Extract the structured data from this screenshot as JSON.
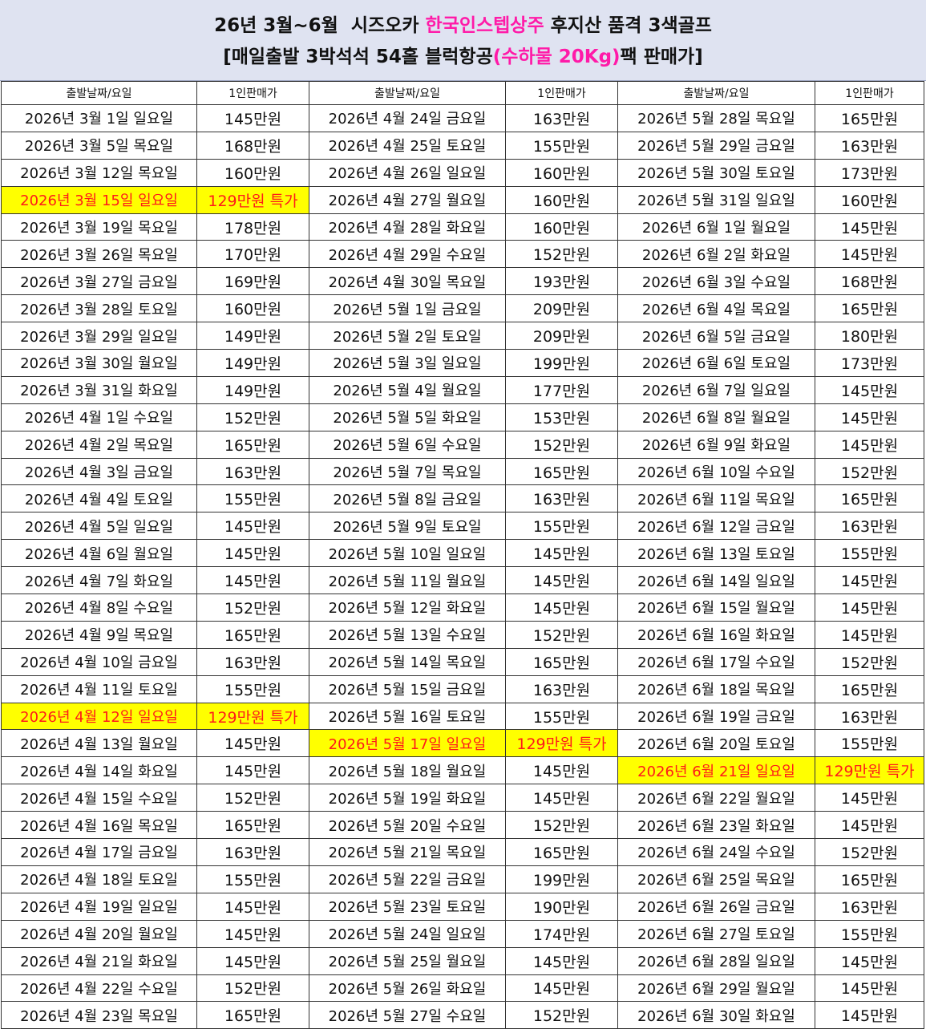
{
  "title": {
    "line1_a": "26년 3월~6월  시즈오카 ",
    "line1_b": "한국인스텝상주",
    "line1_c": " 후지산 품격 3색골프",
    "line2_a": "[매일출발 3박석석 54홀 블럭항공",
    "line2_b": "(수하물 20Kg)",
    "line2_c": "팩 판매가]"
  },
  "headers": {
    "date": "출발날짜/요일",
    "price": "1인판매가"
  },
  "colors": {
    "highlight_bg": "#ffff00",
    "highlight_text": "#ff1a1a",
    "accent_pink": "#ff1aa8",
    "header_bg": "#dfe3f1"
  },
  "rows": [
    {
      "c1": {
        "date": "2026년 3월 1일 일요일",
        "price": "145만원"
      },
      "c2": {
        "date": "2026년 4월 24일 금요일",
        "price": "163만원"
      },
      "c3": {
        "date": "2026년 5월 28일 목요일",
        "price": "165만원"
      }
    },
    {
      "c1": {
        "date": "2026년 3월 5일 목요일",
        "price": "168만원"
      },
      "c2": {
        "date": "2026년 4월 25일 토요일",
        "price": "155만원"
      },
      "c3": {
        "date": "2026년 5월 29일 금요일",
        "price": "163만원"
      }
    },
    {
      "c1": {
        "date": "2026년 3월 12일 목요일",
        "price": "160만원"
      },
      "c2": {
        "date": "2026년 4월 26일 일요일",
        "price": "160만원"
      },
      "c3": {
        "date": "2026년 5월 30일 토요일",
        "price": "173만원"
      }
    },
    {
      "c1": {
        "date": "2026년 3월 15일 일요일",
        "price": "129만원 특가",
        "special": true
      },
      "c2": {
        "date": "2026년 4월 27일 월요일",
        "price": "160만원"
      },
      "c3": {
        "date": "2026년 5월 31일 일요일",
        "price": "160만원"
      }
    },
    {
      "c1": {
        "date": "2026년 3월 19일 목요일",
        "price": "178만원"
      },
      "c2": {
        "date": "2026년 4월 28일 화요일",
        "price": "160만원"
      },
      "c3": {
        "date": "2026년 6월 1일 월요일",
        "price": "145만원"
      }
    },
    {
      "c1": {
        "date": "2026년 3월 26일 목요일",
        "price": "170만원"
      },
      "c2": {
        "date": "2026년 4월 29일 수요일",
        "price": "152만원"
      },
      "c3": {
        "date": "2026년 6월 2일 화요일",
        "price": "145만원"
      }
    },
    {
      "c1": {
        "date": "2026년 3월 27일 금요일",
        "price": "169만원"
      },
      "c2": {
        "date": "2026년 4월 30일 목요일",
        "price": "193만원"
      },
      "c3": {
        "date": "2026년 6월 3일 수요일",
        "price": "168만원"
      }
    },
    {
      "c1": {
        "date": "2026년 3월 28일 토요일",
        "price": "160만원"
      },
      "c2": {
        "date": "2026년 5월 1일 금요일",
        "price": "209만원"
      },
      "c3": {
        "date": "2026년 6월 4일 목요일",
        "price": "165만원"
      }
    },
    {
      "c1": {
        "date": "2026년 3월 29일 일요일",
        "price": "149만원"
      },
      "c2": {
        "date": "2026년 5월 2일 토요일",
        "price": "209만원"
      },
      "c3": {
        "date": "2026년 6월 5일 금요일",
        "price": "180만원"
      }
    },
    {
      "c1": {
        "date": "2026년 3월 30일 월요일",
        "price": "149만원"
      },
      "c2": {
        "date": "2026년 5월 3일 일요일",
        "price": "199만원"
      },
      "c3": {
        "date": "2026년 6월 6일 토요일",
        "price": "173만원"
      }
    },
    {
      "c1": {
        "date": "2026년 3월 31일 화요일",
        "price": "149만원"
      },
      "c2": {
        "date": "2026년 5월 4일 월요일",
        "price": "177만원"
      },
      "c3": {
        "date": "2026년 6월 7일 일요일",
        "price": "145만원"
      }
    },
    {
      "c1": {
        "date": "2026년 4월 1일 수요일",
        "price": "152만원"
      },
      "c2": {
        "date": "2026년 5월 5일 화요일",
        "price": "153만원"
      },
      "c3": {
        "date": "2026년 6월 8일 월요일",
        "price": "145만원"
      }
    },
    {
      "c1": {
        "date": "2026년 4월 2일 목요일",
        "price": "165만원"
      },
      "c2": {
        "date": "2026년 5월 6일 수요일",
        "price": "152만원"
      },
      "c3": {
        "date": "2026년 6월 9일 화요일",
        "price": "145만원"
      }
    },
    {
      "c1": {
        "date": "2026년 4월 3일 금요일",
        "price": "163만원"
      },
      "c2": {
        "date": "2026년 5월 7일 목요일",
        "price": "165만원"
      },
      "c3": {
        "date": "2026년 6월 10일 수요일",
        "price": "152만원"
      }
    },
    {
      "c1": {
        "date": "2026년 4월 4일 토요일",
        "price": "155만원"
      },
      "c2": {
        "date": "2026년 5월 8일 금요일",
        "price": "163만원"
      },
      "c3": {
        "date": "2026년 6월 11일 목요일",
        "price": "165만원"
      }
    },
    {
      "c1": {
        "date": "2026년 4월 5일 일요일",
        "price": "145만원"
      },
      "c2": {
        "date": "2026년 5월 9일 토요일",
        "price": "155만원"
      },
      "c3": {
        "date": "2026년 6월 12일 금요일",
        "price": "163만원"
      }
    },
    {
      "c1": {
        "date": "2026년 4월 6일 월요일",
        "price": "145만원"
      },
      "c2": {
        "date": "2026년 5월 10일 일요일",
        "price": "145만원"
      },
      "c3": {
        "date": "2026년 6월 13일 토요일",
        "price": "155만원"
      }
    },
    {
      "c1": {
        "date": "2026년 4월 7일 화요일",
        "price": "145만원"
      },
      "c2": {
        "date": "2026년 5월 11일 월요일",
        "price": "145만원"
      },
      "c3": {
        "date": "2026년 6월 14일 일요일",
        "price": "145만원"
      }
    },
    {
      "c1": {
        "date": "2026년 4월 8일 수요일",
        "price": "152만원"
      },
      "c2": {
        "date": "2026년 5월 12일 화요일",
        "price": "145만원"
      },
      "c3": {
        "date": "2026년 6월 15일 월요일",
        "price": "145만원"
      }
    },
    {
      "c1": {
        "date": "2026년 4월 9일 목요일",
        "price": "165만원"
      },
      "c2": {
        "date": "2026년 5월 13일 수요일",
        "price": "152만원"
      },
      "c3": {
        "date": "2026년 6월 16일 화요일",
        "price": "145만원"
      }
    },
    {
      "c1": {
        "date": "2026년 4월 10일 금요일",
        "price": "163만원"
      },
      "c2": {
        "date": "2026년 5월 14일 목요일",
        "price": "165만원"
      },
      "c3": {
        "date": "2026년 6월 17일 수요일",
        "price": "152만원"
      }
    },
    {
      "c1": {
        "date": "2026년 4월 11일 토요일",
        "price": "155만원"
      },
      "c2": {
        "date": "2026년 5월 15일 금요일",
        "price": "163만원"
      },
      "c3": {
        "date": "2026년 6월 18일 목요일",
        "price": "165만원"
      }
    },
    {
      "c1": {
        "date": "2026년 4월 12일 일요일",
        "price": "129만원 특가",
        "special": true
      },
      "c2": {
        "date": "2026년 5월 16일 토요일",
        "price": "155만원"
      },
      "c3": {
        "date": "2026년 6월 19일 금요일",
        "price": "163만원"
      }
    },
    {
      "c1": {
        "date": "2026년 4월 13일 월요일",
        "price": "145만원"
      },
      "c2": {
        "date": "2026년 5월 17일 일요일",
        "price": "129만원 특가",
        "special": true
      },
      "c3": {
        "date": "2026년 6월 20일 토요일",
        "price": "155만원"
      }
    },
    {
      "c1": {
        "date": "2026년 4월 14일 화요일",
        "price": "145만원"
      },
      "c2": {
        "date": "2026년 5월 18일 월요일",
        "price": "145만원"
      },
      "c3": {
        "date": "2026년 6월 21일 일요일",
        "price": "129만원 특가",
        "special": true
      }
    },
    {
      "c1": {
        "date": "2026년 4월 15일 수요일",
        "price": "152만원"
      },
      "c2": {
        "date": "2026년 5월 19일 화요일",
        "price": "145만원"
      },
      "c3": {
        "date": "2026년 6월 22일 월요일",
        "price": "145만원"
      }
    },
    {
      "c1": {
        "date": "2026년 4월 16일 목요일",
        "price": "165만원"
      },
      "c2": {
        "date": "2026년 5월 20일 수요일",
        "price": "152만원"
      },
      "c3": {
        "date": "2026년 6월 23일 화요일",
        "price": "145만원"
      }
    },
    {
      "c1": {
        "date": "2026년 4월 17일 금요일",
        "price": "163만원"
      },
      "c2": {
        "date": "2026년 5월 21일 목요일",
        "price": "165만원"
      },
      "c3": {
        "date": "2026년 6월 24일 수요일",
        "price": "152만원"
      }
    },
    {
      "c1": {
        "date": "2026년 4월 18일 토요일",
        "price": "155만원"
      },
      "c2": {
        "date": "2026년 5월 22일 금요일",
        "price": "199만원"
      },
      "c3": {
        "date": "2026년 6월 25일 목요일",
        "price": "165만원"
      }
    },
    {
      "c1": {
        "date": "2026년 4월 19일 일요일",
        "price": "145만원"
      },
      "c2": {
        "date": "2026년 5월 23일 토요일",
        "price": "190만원"
      },
      "c3": {
        "date": "2026년 6월 26일 금요일",
        "price": "163만원"
      }
    },
    {
      "c1": {
        "date": "2026년 4월 20일 월요일",
        "price": "145만원"
      },
      "c2": {
        "date": "2026년 5월 24일 일요일",
        "price": "174만원"
      },
      "c3": {
        "date": "2026년 6월 27일 토요일",
        "price": "155만원"
      }
    },
    {
      "c1": {
        "date": "2026년 4월 21일 화요일",
        "price": "145만원"
      },
      "c2": {
        "date": "2026년 5월 25일 월요일",
        "price": "145만원"
      },
      "c3": {
        "date": "2026년 6월 28일 일요일",
        "price": "145만원"
      }
    },
    {
      "c1": {
        "date": "2026년 4월 22일 수요일",
        "price": "152만원"
      },
      "c2": {
        "date": "2026년 5월 26일 화요일",
        "price": "145만원"
      },
      "c3": {
        "date": "2026년 6월 29일 월요일",
        "price": "145만원"
      }
    },
    {
      "c1": {
        "date": "2026년 4월 23일 목요일",
        "price": "165만원"
      },
      "c2": {
        "date": "2026년 5월 27일 수요일",
        "price": "152만원"
      },
      "c3": {
        "date": "2026년 6월 30일 화요일",
        "price": "145만원"
      }
    }
  ]
}
